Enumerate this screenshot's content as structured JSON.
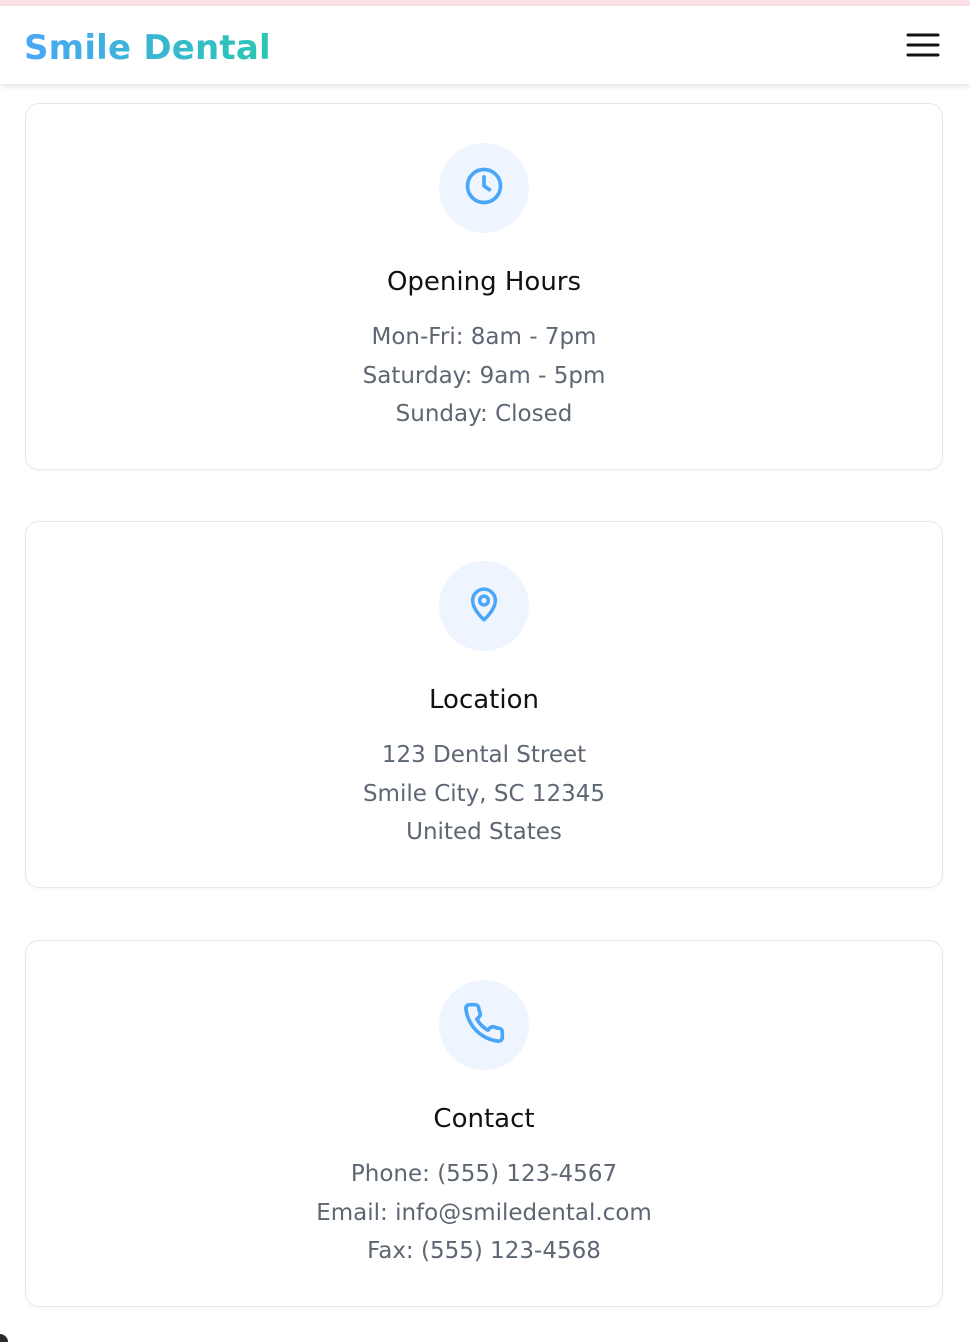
{
  "header": {
    "logo": "Smile Dental",
    "menu_icon": "hamburger-menu-icon"
  },
  "cards": [
    {
      "icon": "clock-icon",
      "title": "Opening Hours",
      "lines": [
        "Mon-Fri: 8am - 7pm",
        "Saturday: 9am - 5pm",
        "Sunday: Closed"
      ]
    },
    {
      "icon": "location-pin-icon",
      "title": "Location",
      "lines": [
        "123 Dental Street",
        "Smile City, SC 12345",
        "United States"
      ]
    },
    {
      "icon": "phone-icon",
      "title": "Contact",
      "lines": [
        "Phone: (555) 123-4567",
        "Email: info@smiledental.com",
        "Fax: (555) 123-4568"
      ]
    }
  ],
  "colors": {
    "accent": "#4aa6f7",
    "accent_end": "#2bc6b2",
    "icon_bg": "#eef5fe",
    "text_muted": "#5d6673",
    "title": "#111111"
  }
}
